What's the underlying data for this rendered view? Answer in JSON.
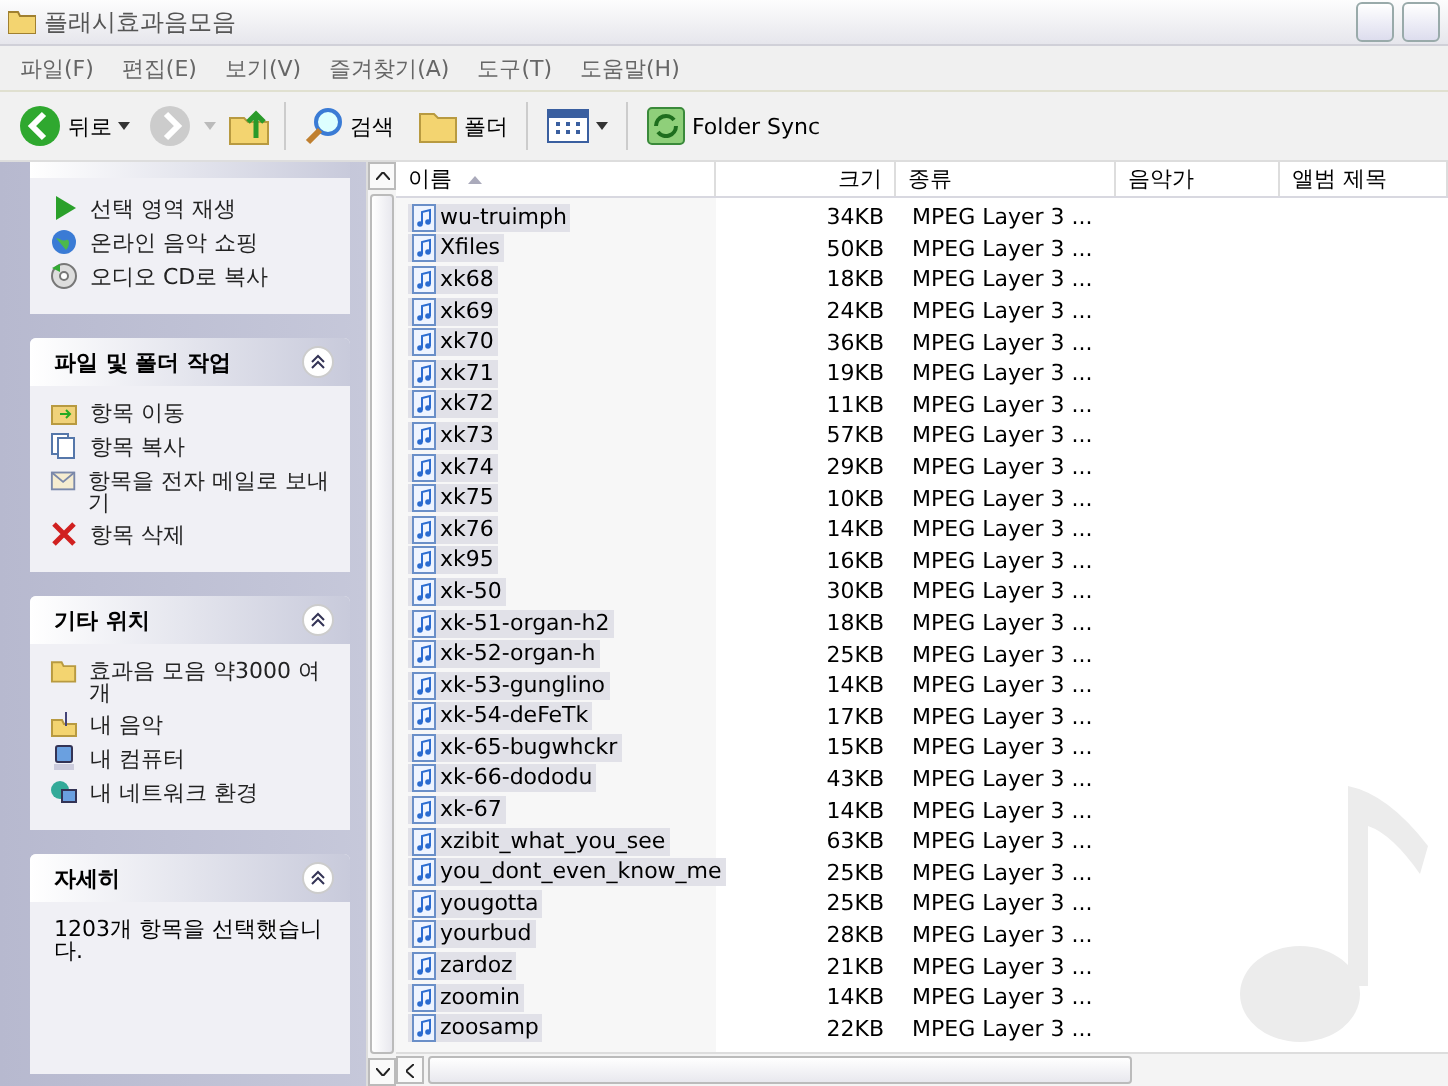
{
  "window": {
    "title": "플래시효과음모음"
  },
  "menu": [
    {
      "label": "파일(F)"
    },
    {
      "label": "편집(E)"
    },
    {
      "label": "보기(V)"
    },
    {
      "label": "즐겨찾기(A)"
    },
    {
      "label": "도구(T)"
    },
    {
      "label": "도움말(H)"
    }
  ],
  "toolbar": {
    "back": "뒤로",
    "search": "검색",
    "folders": "폴더",
    "sync": "Folder Sync"
  },
  "sidebar": {
    "panels": [
      {
        "expanded": true,
        "items": [
          {
            "label": "선택 영역 재생"
          },
          {
            "label": "온라인 음악 쇼핑"
          },
          {
            "label": "오디오 CD로 복사"
          }
        ]
      },
      {
        "title": "파일 및 폴더 작업",
        "expanded": true,
        "items": [
          {
            "label": "항목 이동"
          },
          {
            "label": "항목 복사"
          },
          {
            "label": "항목을 전자 메일로 보내기"
          },
          {
            "label": "항목 삭제"
          }
        ]
      },
      {
        "title": "기타 위치",
        "expanded": true,
        "items": [
          {
            "label": "효과음 모음 약3000 여개"
          },
          {
            "label": "내 음악"
          },
          {
            "label": "내 컴퓨터"
          },
          {
            "label": "내 네트워크 환경"
          }
        ]
      },
      {
        "title": "자세히",
        "expanded": true,
        "text": "1203개 항목을 선택했습니다."
      }
    ]
  },
  "table": {
    "columns": [
      {
        "label": "이름",
        "sorted": true
      },
      {
        "label": "크기",
        "sorted": false
      },
      {
        "label": "종류",
        "sorted": false
      },
      {
        "label": "음악가",
        "sorted": false
      },
      {
        "label": "앨범 제목",
        "sorted": false
      }
    ],
    "rows": [
      {
        "name": "wu-truimph",
        "size": "34KB",
        "type": "MPEG Layer 3 ...",
        "selected": true
      },
      {
        "name": "Xfiles",
        "size": "50KB",
        "type": "MPEG Layer 3 ...",
        "selected": true
      },
      {
        "name": "xk68",
        "size": "18KB",
        "type": "MPEG Layer 3 ...",
        "selected": true
      },
      {
        "name": "xk69",
        "size": "24KB",
        "type": "MPEG Layer 3 ...",
        "selected": true
      },
      {
        "name": "xk70",
        "size": "36KB",
        "type": "MPEG Layer 3 ...",
        "selected": true
      },
      {
        "name": "xk71",
        "size": "19KB",
        "type": "MPEG Layer 3 ...",
        "selected": true
      },
      {
        "name": "xk72",
        "size": "11KB",
        "type": "MPEG Layer 3 ...",
        "selected": true
      },
      {
        "name": "xk73",
        "size": "57KB",
        "type": "MPEG Layer 3 ...",
        "selected": true
      },
      {
        "name": "xk74",
        "size": "29KB",
        "type": "MPEG Layer 3 ...",
        "selected": true
      },
      {
        "name": "xk75",
        "size": "10KB",
        "type": "MPEG Layer 3 ...",
        "selected": true
      },
      {
        "name": "xk76",
        "size": "14KB",
        "type": "MPEG Layer 3 ...",
        "selected": true
      },
      {
        "name": "xk95",
        "size": "16KB",
        "type": "MPEG Layer 3 ...",
        "selected": true
      },
      {
        "name": "xk-50",
        "size": "30KB",
        "type": "MPEG Layer 3 ...",
        "selected": true
      },
      {
        "name": "xk-51-organ-h2",
        "size": "18KB",
        "type": "MPEG Layer 3 ...",
        "selected": true
      },
      {
        "name": "xk-52-organ-h",
        "size": "25KB",
        "type": "MPEG Layer 3 ...",
        "selected": true
      },
      {
        "name": "xk-53-gunglino",
        "size": "14KB",
        "type": "MPEG Layer 3 ...",
        "selected": true
      },
      {
        "name": "xk-54-deFeTk",
        "size": "17KB",
        "type": "MPEG Layer 3 ...",
        "selected": true
      },
      {
        "name": "xk-65-bugwhckr",
        "size": "15KB",
        "type": "MPEG Layer 3 ...",
        "selected": true
      },
      {
        "name": "xk-66-dododu",
        "size": "43KB",
        "type": "MPEG Layer 3 ...",
        "selected": true
      },
      {
        "name": "xk-67",
        "size": "14KB",
        "type": "MPEG Layer 3 ...",
        "selected": true
      },
      {
        "name": "xzibit_what_you_see",
        "size": "63KB",
        "type": "MPEG Layer 3 ...",
        "selected": true
      },
      {
        "name": "you_dont_even_know_me",
        "size": "25KB",
        "type": "MPEG Layer 3 ...",
        "selected": true
      },
      {
        "name": "yougotta",
        "size": "25KB",
        "type": "MPEG Layer 3 ...",
        "selected": true
      },
      {
        "name": "yourbud",
        "size": "28KB",
        "type": "MPEG Layer 3 ...",
        "selected": true
      },
      {
        "name": "zardoz",
        "size": "21KB",
        "type": "MPEG Layer 3 ...",
        "selected": true
      },
      {
        "name": "zoomin",
        "size": "14KB",
        "type": "MPEG Layer 3 ...",
        "selected": true
      },
      {
        "name": "zoosamp",
        "size": "22KB",
        "type": "MPEG Layer 3 ...",
        "selected": true
      }
    ]
  }
}
